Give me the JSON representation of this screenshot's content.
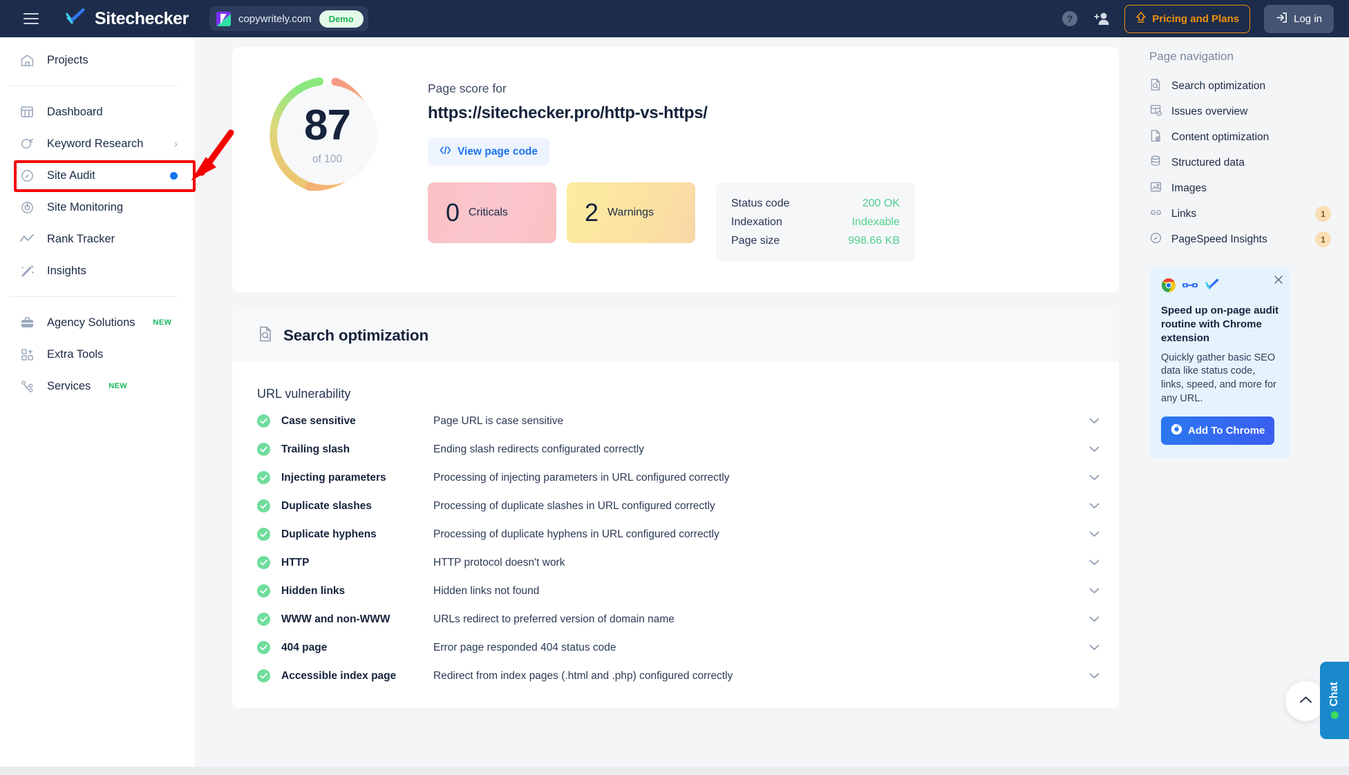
{
  "topbar": {
    "menu_icon": "hamburger-menu-icon",
    "brand": "Sitechecker",
    "project_name": "copywritely.com",
    "project_badge": "Demo",
    "help_icon": "help-circle-icon",
    "invite_icon": "add-user-icon",
    "pricing_label": "Pricing and Plans",
    "login_label": "Log in"
  },
  "sidebar": {
    "items": [
      {
        "label": "Projects",
        "icon": "home-icon"
      },
      {
        "label": "Dashboard",
        "icon": "dashboard-grid-icon"
      },
      {
        "label": "Keyword Research",
        "icon": "keyword-search-icon",
        "chevron": "›"
      },
      {
        "label": "Site Audit",
        "icon": "gauge-icon",
        "dot": true
      },
      {
        "label": "Site Monitoring",
        "icon": "radar-icon"
      },
      {
        "label": "Rank Tracker",
        "icon": "trend-line-icon"
      },
      {
        "label": "Insights",
        "icon": "magic-wand-icon"
      },
      {
        "label": "Agency Solutions",
        "icon": "briefcase-icon",
        "tag": "NEW"
      },
      {
        "label": "Extra Tools",
        "icon": "extra-tools-icon"
      },
      {
        "label": "Services",
        "icon": "services-node-icon",
        "tag": "NEW"
      }
    ]
  },
  "annotation": {
    "highlight_color": "#f50000",
    "arrow_color": "#f50000",
    "target": "Site Audit"
  },
  "score": {
    "value": "87",
    "of_label": "of 100",
    "page_score_label": "Page score for",
    "url": "https://sitechecker.pro/http-vs-https/",
    "view_code_label": "View page code",
    "view_code_icon": "code-brackets-icon",
    "stats": [
      {
        "count": "0",
        "label": "Criticals",
        "color": "#f9c3c6"
      },
      {
        "count": "2",
        "label": "Warnings",
        "color": "#fbe6a0"
      }
    ],
    "status": [
      {
        "key": "Status code",
        "value": "200 OK"
      },
      {
        "key": "Indexation",
        "value": "Indexable"
      },
      {
        "key": "Page size",
        "value": "998.66 KB"
      }
    ],
    "status_value_color": "#52cf8e"
  },
  "section": {
    "title": "Search optimization",
    "icon": "document-search-icon",
    "subsection": "URL vulnerability",
    "rows": [
      {
        "name": "Case sensitive",
        "desc": "Page URL is case sensitive",
        "status": "ok"
      },
      {
        "name": "Trailing slash",
        "desc": "Ending slash redirects configurated correctly",
        "status": "ok"
      },
      {
        "name": "Injecting parameters",
        "desc": "Processing of injecting parameters in URL configured correctly",
        "status": "ok"
      },
      {
        "name": "Duplicate slashes",
        "desc": "Processing of duplicate slashes in URL configured correctly",
        "status": "ok"
      },
      {
        "name": "Duplicate hyphens",
        "desc": "Processing of duplicate hyphens in URL configured correctly",
        "status": "ok"
      },
      {
        "name": "HTTP",
        "desc": "HTTP protocol doesn't work",
        "status": "ok"
      },
      {
        "name": "Hidden links",
        "desc": "Hidden links not found",
        "status": "ok"
      },
      {
        "name": "WWW and non-WWW",
        "desc": "URLs redirect to preferred version of domain name",
        "status": "ok"
      },
      {
        "name": "404 page",
        "desc": "Error page responded 404 status code",
        "status": "ok"
      },
      {
        "name": "Accessible index page",
        "desc": "Redirect from index pages (.html and .php) configured correctly",
        "status": "ok"
      }
    ]
  },
  "page_nav": {
    "title": "Page navigation",
    "items": [
      {
        "label": "Search optimization",
        "icon": "document-search-icon"
      },
      {
        "label": "Issues overview",
        "icon": "issues-grid-icon"
      },
      {
        "label": "Content optimization",
        "icon": "document-gear-icon"
      },
      {
        "label": "Structured data",
        "icon": "database-icon"
      },
      {
        "label": "Images",
        "icon": "image-icon"
      },
      {
        "label": "Links",
        "icon": "link-icon",
        "badge": "1"
      },
      {
        "label": "PageSpeed Insights",
        "icon": "gauge-icon",
        "badge": "1"
      }
    ]
  },
  "promo": {
    "close_icon": "close-icon",
    "icons": [
      "chrome-icon",
      "plug-connector-icon",
      "sitechecker-check-icon"
    ],
    "title": "Speed up on-page audit routine with Chrome extension",
    "text": "Quickly gather basic SEO data like status code, links, speed, and more for any URL.",
    "button_label": "Add To Chrome",
    "button_icon": "chrome-icon"
  },
  "widgets": {
    "scroll_top_icon": "chevron-up-icon",
    "chat_label": "Chat",
    "chat_status_color": "#3ddc62"
  }
}
